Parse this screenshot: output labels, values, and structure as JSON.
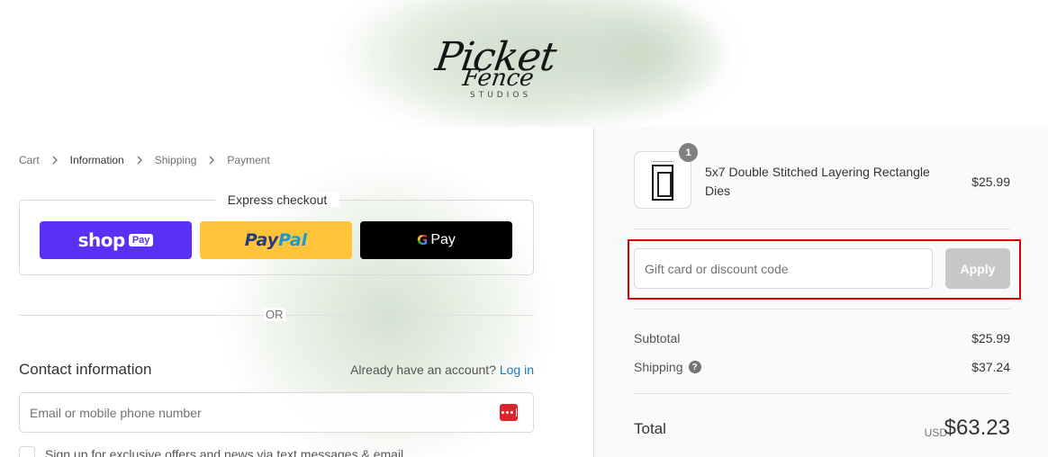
{
  "brand": {
    "logo_line1": "Picket",
    "logo_line2": "Fence",
    "logo_line3": "STUDIOS"
  },
  "breadcrumb": [
    {
      "label": "Cart"
    },
    {
      "label": "Information"
    },
    {
      "label": "Shipping"
    },
    {
      "label": "Payment"
    }
  ],
  "express": {
    "title": "Express checkout",
    "shop_pay_word": "shop",
    "shop_pay_pill": "Pay",
    "paypal_pay": "Pay",
    "paypal_pal": "Pal",
    "gpay_g": "G",
    "gpay_label": "Pay"
  },
  "divider_text": "OR",
  "contact": {
    "title": "Contact information",
    "have_account": "Already have an account?",
    "login_label": "Log in",
    "email_placeholder": "Email or mobile phone number",
    "signup_label": "Sign up for exclusive offers and news via text messages & email"
  },
  "order": {
    "product_name": "5x7 Double Stitched Layering Rectangle Dies",
    "product_price": "$25.99",
    "quantity": "1",
    "discount_placeholder": "Gift card or discount code",
    "apply_label": "Apply",
    "subtotal_label": "Subtotal",
    "subtotal_value": "$25.99",
    "shipping_label": "Shipping",
    "shipping_help": "?",
    "shipping_value": "$37.24",
    "total_label": "Total",
    "total_currency": "USD",
    "total_value": "$63.23"
  },
  "colors": {
    "shop_pay": "#5a31f4",
    "paypal": "#ffc439",
    "gpay": "#000000",
    "link": "#197bbd",
    "highlight": "#e00000"
  }
}
